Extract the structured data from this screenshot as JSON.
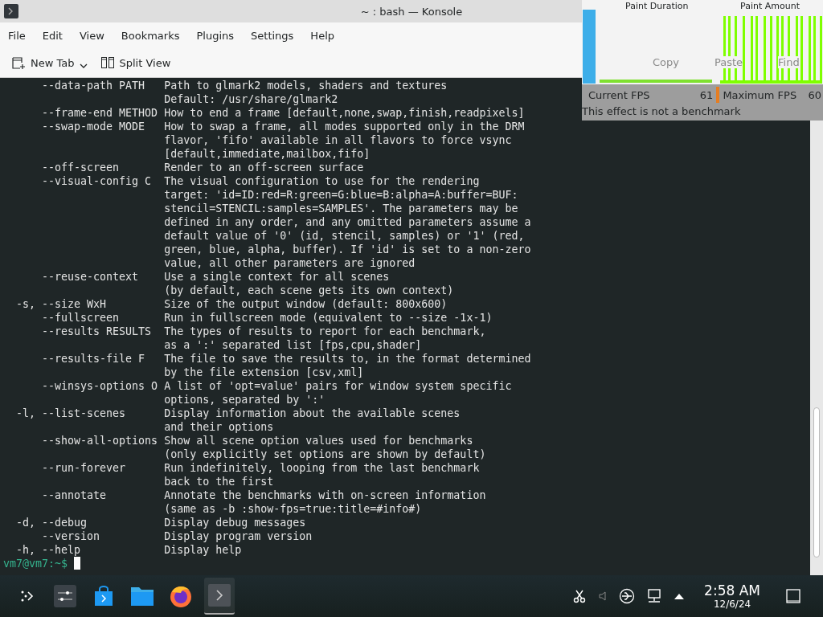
{
  "window": {
    "title": "~ : bash — Konsole"
  },
  "menu": [
    "File",
    "Edit",
    "View",
    "Bookmarks",
    "Plugins",
    "Settings",
    "Help"
  ],
  "toolbar": [
    {
      "label": "New Tab",
      "kind": "dropdown"
    },
    {
      "label": "Split View",
      "kind": "plain"
    }
  ],
  "terminal": {
    "lines": [
      {
        "kind": "long",
        "option": "--data-path PATH",
        "text": "Path to glmark2 models, shaders and textures"
      },
      {
        "kind": "cont",
        "text": "Default: /usr/share/glmark2"
      },
      {
        "kind": "long",
        "option": "--frame-end METHOD",
        "text": "How to end a frame [default,none,swap,finish,readpixels]"
      },
      {
        "kind": "long",
        "option": "--swap-mode MODE",
        "text": "How to swap a frame, all modes supported only in the DRM"
      },
      {
        "kind": "cont",
        "text": "flavor, 'fifo' available in all flavors to force vsync"
      },
      {
        "kind": "cont",
        "text": "[default,immediate,mailbox,fifo]"
      },
      {
        "kind": "long",
        "option": "--off-screen",
        "text": "Render to an off-screen surface"
      },
      {
        "kind": "long",
        "option": "--visual-config C",
        "text": "The visual configuration to use for the rendering"
      },
      {
        "kind": "cont",
        "text": "target: 'id=ID:red=R:green=G:blue=B:alpha=A:buffer=BUF:"
      },
      {
        "kind": "cont",
        "text": "stencil=STENCIL:samples=SAMPLES'. The parameters may be"
      },
      {
        "kind": "cont",
        "text": "defined in any order, and any omitted parameters assume a"
      },
      {
        "kind": "cont",
        "text": "default value of '0' (id, stencil, samples) or '1' (red,"
      },
      {
        "kind": "cont",
        "text": "green, blue, alpha, buffer). If 'id' is set to a non-zero"
      },
      {
        "kind": "cont",
        "text": "value, all other parameters are ignored"
      },
      {
        "kind": "long",
        "option": "--reuse-context",
        "text": "Use a single context for all scenes"
      },
      {
        "kind": "cont",
        "text": "(by default, each scene gets its own context)"
      },
      {
        "kind": "short",
        "option": "-s, --size WxH",
        "text": "Size of the output window (default: 800x600)"
      },
      {
        "kind": "long",
        "option": "--fullscreen",
        "text": "Run in fullscreen mode (equivalent to --size -1x-1)"
      },
      {
        "kind": "long",
        "option": "--results RESULTS",
        "text": "The types of results to report for each benchmark,"
      },
      {
        "kind": "cont",
        "text": "as a ':' separated list [fps,cpu,shader]"
      },
      {
        "kind": "long",
        "option": "--results-file F",
        "text": "The file to save the results to, in the format determined"
      },
      {
        "kind": "cont",
        "text": "by the file extension [csv,xml]"
      },
      {
        "kind": "long",
        "option": "--winsys-options O",
        "text": "A list of 'opt=value' pairs for window system specific"
      },
      {
        "kind": "cont",
        "text": "options, separated by ':'"
      },
      {
        "kind": "short",
        "option": "-l, --list-scenes",
        "text": "Display information about the available scenes"
      },
      {
        "kind": "cont",
        "text": "and their options"
      },
      {
        "kind": "long",
        "option": "--show-all-options",
        "text": "Show all scene option values used for benchmarks"
      },
      {
        "kind": "cont",
        "text": "(only explicitly set options are shown by default)"
      },
      {
        "kind": "long",
        "option": "--run-forever",
        "text": "Run indefinitely, looping from the last benchmark"
      },
      {
        "kind": "cont",
        "text": "back to the first"
      },
      {
        "kind": "long",
        "option": "--annotate",
        "text": "Annotate the benchmarks with on-screen information"
      },
      {
        "kind": "cont",
        "text": "(same as -b :show-fps=true:title=#info#)"
      },
      {
        "kind": "short",
        "option": "-d, --debug",
        "text": "Display debug messages"
      },
      {
        "kind": "long",
        "option": "--version",
        "text": "Display program version"
      },
      {
        "kind": "short",
        "option": "-h, --help",
        "text": "Display help"
      }
    ],
    "prompt": "vm7@vm7:~$"
  },
  "overlay": {
    "titles": [
      "Paint Duration",
      "Paint Amount"
    ],
    "ghost_toolbar": [
      "Copy",
      "Paste",
      "Find"
    ],
    "current_fps": {
      "label": "Current FPS",
      "value": "61"
    },
    "maximum_fps": {
      "label": "Maximum FPS",
      "value": "60"
    },
    "note": "This effect is not a benchmark"
  },
  "taskbar": {
    "apps": [
      {
        "kind": "launcher",
        "active": false
      },
      {
        "kind": "settings",
        "active": false
      },
      {
        "kind": "store",
        "active": false
      },
      {
        "kind": "files",
        "active": false
      },
      {
        "kind": "browser",
        "active": false
      },
      {
        "kind": "terminal",
        "active": true
      }
    ],
    "time": "2:58 AM",
    "date": "12/6/24"
  }
}
